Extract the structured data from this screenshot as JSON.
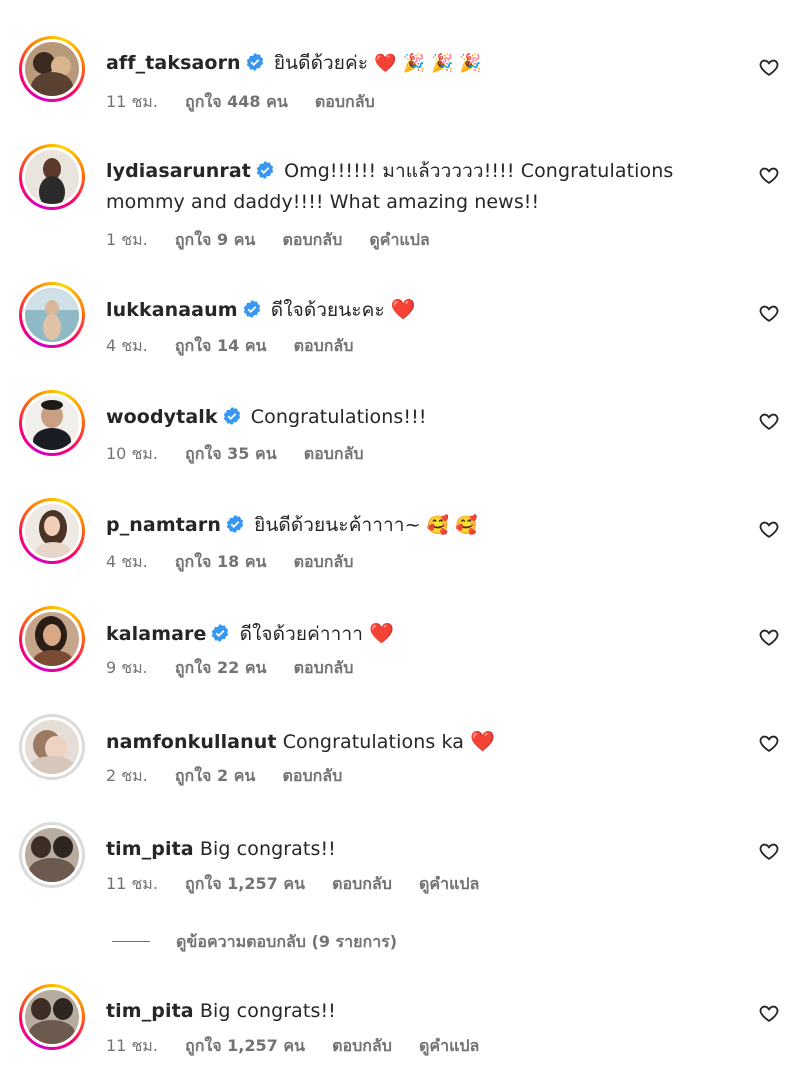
{
  "comments": [
    {
      "username": "aff_taksaorn",
      "verified": true,
      "text": "ยินดีด้วยค่ะ",
      "emoji": "❤️ 🎉 🎉 🎉",
      "time": "11 ชม.",
      "likes": "ถูกใจ 448 คน",
      "reply": "ตอบกลับ",
      "translate": ""
    },
    {
      "username": "lydiasarunrat",
      "verified": true,
      "text": "Omg!!!!!! มาแล้ววววว!!!! Congratulations mommy and daddy!!!! What amazing news!!",
      "emoji": "",
      "time": "1 ชม.",
      "likes": "ถูกใจ 9 คน",
      "reply": "ตอบกลับ",
      "translate": "ดูคำแปล"
    },
    {
      "username": "lukkanaaum",
      "verified": true,
      "text": "ดีใจด้วยนะคะ",
      "emoji": "❤️",
      "time": "4 ชม.",
      "likes": "ถูกใจ 14 คน",
      "reply": "ตอบกลับ",
      "translate": ""
    },
    {
      "username": "woodytalk",
      "verified": true,
      "text": "Congratulations!!!",
      "emoji": "",
      "time": "10 ชม.",
      "likes": "ถูกใจ 35 คน",
      "reply": "ตอบกลับ",
      "translate": ""
    },
    {
      "username": "p_namtarn",
      "verified": true,
      "text": "ยินดีด้วยนะค้าาาา~",
      "emoji": "🥰 🥰",
      "time": "4 ชม.",
      "likes": "ถูกใจ 18 คน",
      "reply": "ตอบกลับ",
      "translate": ""
    },
    {
      "username": "kalamare",
      "verified": true,
      "text": "ดีใจด้วยค่าาาา",
      "emoji": "❤️",
      "time": "9 ชม.",
      "likes": "ถูกใจ 22 คน",
      "reply": "ตอบกลับ",
      "translate": ""
    },
    {
      "username": "namfonkullanut",
      "verified": false,
      "text": "Congratulations ka",
      "emoji": "❤️",
      "time": "2 ชม.",
      "likes": "ถูกใจ 2 คน",
      "reply": "ตอบกลับ",
      "translate": ""
    },
    {
      "username": "tim_pita",
      "verified": false,
      "text": "Big congrats!!",
      "emoji": "",
      "time": "11 ชม.",
      "likes": "ถูกใจ 1,257 คน",
      "reply": "ตอบกลับ",
      "translate": "ดูคำแปล"
    },
    {
      "username": "tim_pita",
      "verified": false,
      "text": "Big congrats!!",
      "emoji": "",
      "time": "11 ชม.",
      "likes": "ถูกใจ 1,257 คน",
      "reply": "ตอบกลับ",
      "translate": "ดูคำแปล"
    }
  ],
  "view_replies": "ดูข้อความตอบกลับ (9 รายการ)",
  "colors": {
    "verified": "#3897f0",
    "meta": "#737373",
    "text": "#262626",
    "heart": "#ed1c24"
  }
}
